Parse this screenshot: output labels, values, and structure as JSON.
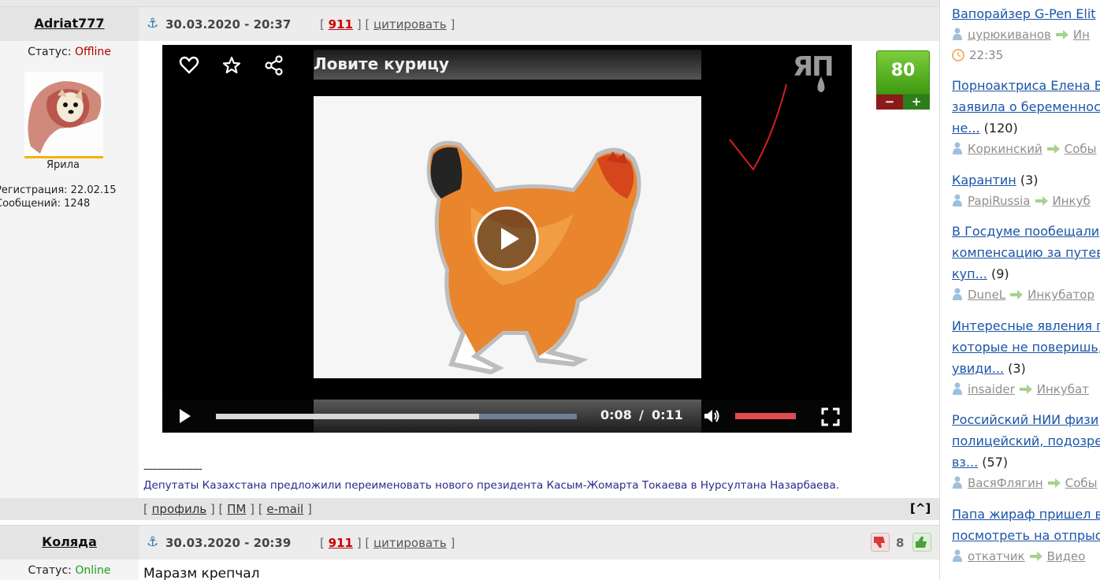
{
  "post1": {
    "username": "Adriat777",
    "date": "30.03.2020 - 20:37",
    "number": "911",
    "quote_label": "цитировать",
    "status_label": "Статус:",
    "status": "Offline",
    "avatar_name": "Ярила",
    "registration": "Регистрация: 22.02.15",
    "messages": "Сообщений: 1248",
    "rating": "80",
    "rate_minus": "−",
    "rate_plus": "+",
    "signature_dashes": "--------------------",
    "signature": "Депутаты Казахстана предложили переименовать нового президента Касым-Жомарта Токаева в Нурсултана Назарбаева.",
    "video": {
      "title": "Ловите курицу",
      "logo": "ЯП",
      "current_time": "0:08",
      "separator": "/",
      "duration": "0:11",
      "progress": 0.73,
      "volume": 1.0
    },
    "footer": {
      "profile": "профиль",
      "pm": "ПМ",
      "email": "e-mail",
      "to_top": "[^]"
    }
  },
  "post2": {
    "username": "Коляда",
    "date": "30.03.2020 - 20:39",
    "number": "911",
    "quote_label": "цитировать",
    "status_label": "Статус:",
    "status": "Online",
    "vote_count": "8",
    "text": "Маразм крепчал"
  },
  "sidebar": {
    "items": [
      {
        "title_lines": [
          "Вапорайзер G-Pen Elit"
        ],
        "count": "",
        "author": "",
        "section": "",
        "extra_author": "цурюкиванов",
        "extra_section": "Ин",
        "time": "22:35"
      },
      {
        "title_lines": [
          "Порноактриса Елена В",
          "заявила о беременност",
          "не..."
        ],
        "count": "(120)",
        "author": "Коркинский",
        "section": "Собы"
      },
      {
        "title_lines": [
          "Карантин"
        ],
        "count": "(3)",
        "author": "PapiRussia",
        "section": "Инкуб"
      },
      {
        "title_lines": [
          "В Госдуме пообещали",
          "компенсацию за путев",
          "куп..."
        ],
        "count": "(9)",
        "author": "DuneL",
        "section": "Инкубатор"
      },
      {
        "title_lines": [
          "Интересные явления п",
          "которые не поверишь,",
          "увиди..."
        ],
        "count": "(3)",
        "author": "insaider",
        "section": "Инкубат"
      },
      {
        "title_lines": [
          "Российский НИИ физи",
          "полицейский, подозре",
          "вз..."
        ],
        "count": "(57)",
        "author": "ВасяФлягин",
        "section": "Собы"
      },
      {
        "title_lines": [
          "Папа жираф пришел в",
          "посмотреть на отпрыс"
        ],
        "count": "",
        "author": "откатчик",
        "section": "Видео"
      }
    ]
  }
}
